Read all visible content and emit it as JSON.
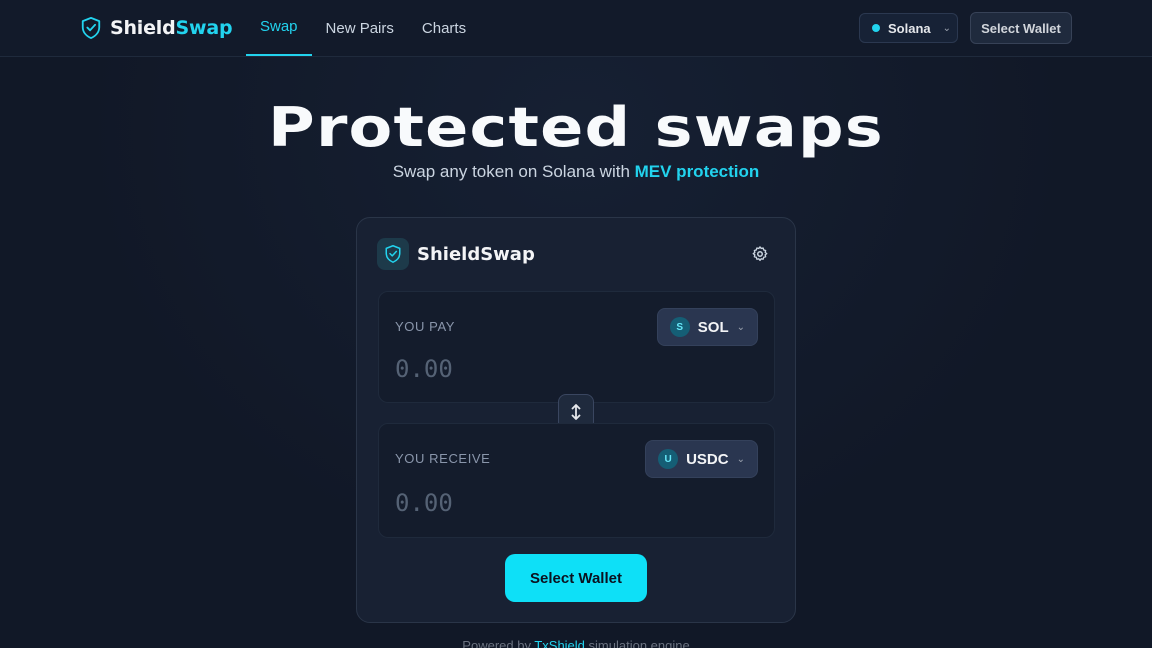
{
  "nav": {
    "brand_main": "Shield",
    "brand_accent": "Swap",
    "tabs": [
      {
        "label": "Swap",
        "active": true
      },
      {
        "label": "New Pairs",
        "active": false
      },
      {
        "label": "Charts",
        "active": false
      }
    ],
    "network": "Solana",
    "wallet_button": "Select Wallet"
  },
  "hero": {
    "title": "Protected swaps",
    "subtitle_prefix": "Swap any token on Solana with ",
    "subtitle_accent": "MEV protection"
  },
  "card": {
    "title": "ShieldSwap",
    "pay": {
      "label": "YOU PAY",
      "placeholder": "0.00",
      "token_letter": "S",
      "token": "SOL"
    },
    "receive": {
      "label": "YOU RECEIVE",
      "placeholder": "0.00",
      "token_letter": "U",
      "token": "USDC"
    },
    "cta": "Select Wallet"
  },
  "footer": {
    "prefix": "Powered by ",
    "accent": "TxShield",
    "suffix": " simulation engine"
  },
  "colors": {
    "accent": "#22d3ee",
    "background": "#111827",
    "cta": "#0ee0f7"
  },
  "icons": {
    "brand": "shield-check-icon",
    "settings": "gear-icon",
    "swap_direction": "arrows-up-down-icon",
    "dropdown": "chevron-down-icon"
  }
}
